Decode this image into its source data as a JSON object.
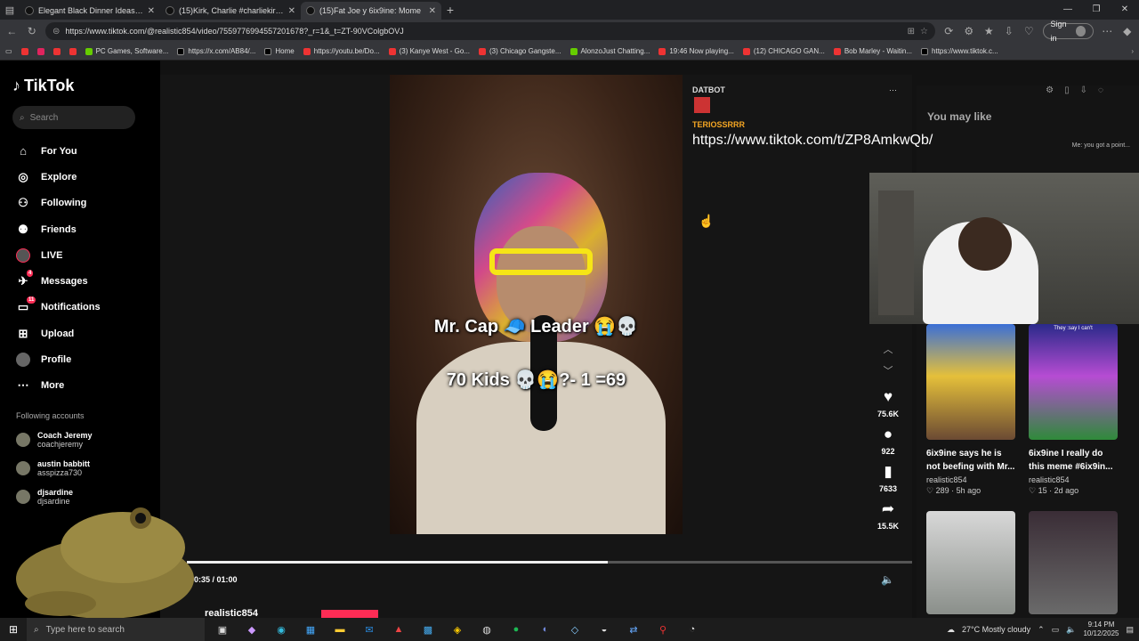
{
  "browser": {
    "tabs": [
      {
        "title": "Elegant Black Dinner Ideas for Sp"
      },
      {
        "title": "(15)Kirk, Charlie #charliekirk #fre"
      },
      {
        "title": "(15)Fat Joe y 6ix9ine: Mome"
      }
    ],
    "new_tab": "+",
    "url": "https://www.tiktok.com/@realistic854/video/7559776994557201678?_r=1&_t=ZT-90VColgbOVJ",
    "signin_label": "Sign in",
    "bookmarks": [
      {
        "label": "PC Games, Software..."
      },
      {
        "label": "https://x.com/AB84/..."
      },
      {
        "label": "Home"
      },
      {
        "label": "https://youtu.be/Do..."
      },
      {
        "label": "(3) Kanye West - Go..."
      },
      {
        "label": "(3) Chicago Gangste..."
      },
      {
        "label": "AlonzoJust Chatting..."
      },
      {
        "label": "19:46 Now playing..."
      },
      {
        "label": "(12) CHICAGO GAN..."
      },
      {
        "label": "Bob Marley - Waitin..."
      },
      {
        "label": "https://www.tiktok.c..."
      }
    ]
  },
  "sidebar": {
    "logo": "TikTok",
    "search_placeholder": "Search",
    "items": [
      {
        "label": "For You"
      },
      {
        "label": "Explore"
      },
      {
        "label": "Following"
      },
      {
        "label": "Friends"
      },
      {
        "label": "LIVE"
      },
      {
        "label": "Messages",
        "badge": "4"
      },
      {
        "label": "Notifications",
        "badge": "11"
      },
      {
        "label": "Upload"
      },
      {
        "label": "Profile"
      },
      {
        "label": "More"
      }
    ],
    "following_title": "Following accounts",
    "accounts": [
      {
        "name": "Coach Jeremy",
        "handle": "coachjeremy"
      },
      {
        "name": "austin babbitt",
        "handle": "asspizza730"
      },
      {
        "name": "djsardine",
        "handle": "djsardine"
      }
    ]
  },
  "video": {
    "caption_line1": "Mr. Cap 🧢 Leader 😭💀",
    "caption_line2": "70 Kids 💀😭?- 1 =69",
    "progress": 0.58,
    "time": "00:35 / 01:00",
    "author": "realistic854",
    "likes": "75.6K",
    "comments": "922",
    "saves": "7633",
    "shares": "15.5K"
  },
  "chat": {
    "user1": "DATBOT",
    "user2": "TERIOSSRRR",
    "message": "https://www.tiktok.com/t/ZP8AmkwQb/"
  },
  "recommend": {
    "title": "You may like",
    "quote": "Me: you got a point...",
    "cards": [
      {
        "title": "6ix9ine says he is not beefing with Mr...",
        "author": "realistic854",
        "meta": "♡ 289 · 5h ago",
        "thumb_text": ""
      },
      {
        "title": "6ix9ine I really do this meme #6ix9in...",
        "author": "realistic854",
        "meta": "♡ 15 · 2d ago",
        "thumb_text": "They :say I can't"
      },
      {
        "title": "",
        "author": "",
        "meta": "",
        "thumb_text": ""
      },
      {
        "title": "",
        "author": "",
        "meta": "",
        "thumb_text": ""
      }
    ]
  },
  "taskbar": {
    "search_placeholder": "Type here to search",
    "weather": "27°C  Mostly cloudy",
    "time": "9:14 PM",
    "date": "10/12/2025"
  },
  "colors": {
    "accent": "#fe2c55",
    "chat_user2": "#f5a623"
  }
}
